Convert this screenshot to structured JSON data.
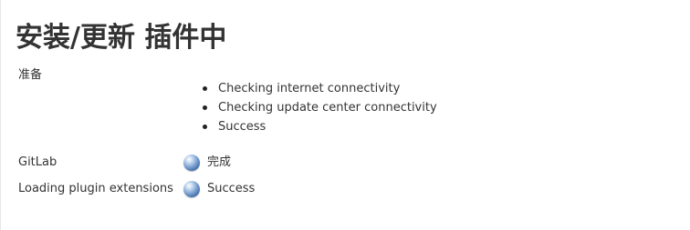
{
  "page": {
    "title": "安装/更新 插件中"
  },
  "preparation": {
    "label": "准备",
    "checks": [
      "Checking internet connectivity",
      "Checking update center connectivity",
      "Success"
    ]
  },
  "jobs": [
    {
      "name": "GitLab",
      "status": "完成",
      "icon": "blue-ball-icon",
      "color": "#4a76b3"
    },
    {
      "name": "Loading plugin extensions",
      "status": "Success",
      "icon": "blue-ball-icon",
      "color": "#4a76b3"
    }
  ]
}
